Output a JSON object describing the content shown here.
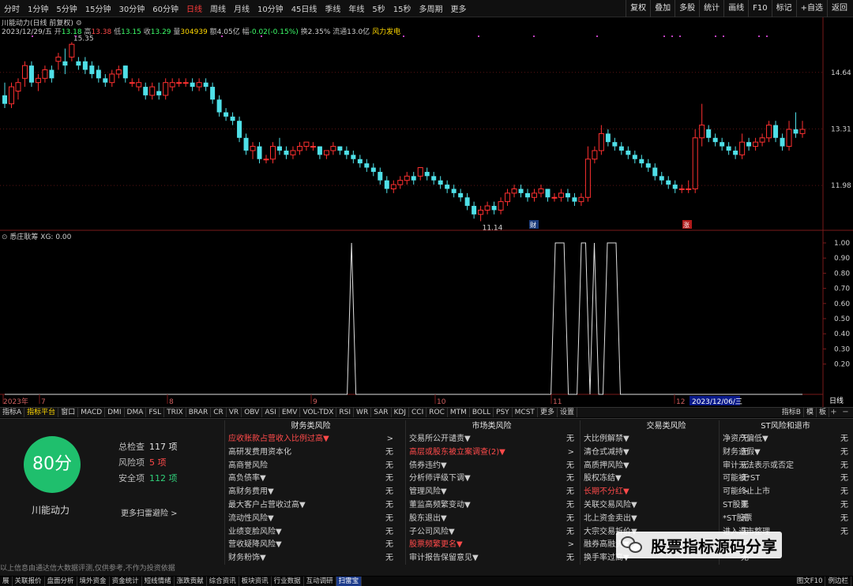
{
  "periods": [
    "分时",
    "1分钟",
    "5分钟",
    "15分钟",
    "30分钟",
    "60分钟",
    "日线",
    "周线",
    "月线",
    "10分钟",
    "45日线",
    "季线",
    "年线",
    "5秒",
    "15秒",
    "多周期",
    "更多"
  ],
  "active_period": "日线",
  "right_buttons": [
    "复权",
    "叠加",
    "多股",
    "统计",
    "画线",
    "F10",
    "标记",
    "+自选",
    "返回"
  ],
  "chart_header": {
    "name": "川能动力(日线 前复权)",
    "date": "2023/12/29/五",
    "open_lbl": "开",
    "open": "13.18",
    "high_lbl": "高",
    "high": "13.38",
    "low_lbl": "低",
    "low": "13.15",
    "close_lbl": "收",
    "close": "13.29",
    "vol_lbl": "量",
    "vol": "304939",
    "amt_lbl": "额",
    "amt": "4.05亿",
    "chg_lbl": "幅",
    "chg": "-0.02(-0.15%)",
    "turn_lbl": "换",
    "turn": "2.35%",
    "float_lbl": "流通",
    "float": "13.0亿",
    "concept": "风力发电"
  },
  "price_marks": {
    "high": "15.35",
    "low": "11.14",
    "badge_cai": "财",
    "badge_zhang": "涨"
  },
  "price_axis": [
    "14.64",
    "13.31",
    "11.98"
  ],
  "indicator_title": "悉庄耿筹  XG: 0.00",
  "indicator_axis": [
    "1.00",
    "0.90",
    "0.80",
    "0.70",
    "0.60",
    "0.50",
    "0.40",
    "0.30",
    "0.20"
  ],
  "time_axis": [
    "2023年",
    "7",
    "8",
    "9",
    "10",
    "11",
    "12"
  ],
  "time_cursor": "2023/12/06/三",
  "day_tab": "日线",
  "ind_tabs": [
    "指标A",
    "指标平台",
    "窗口",
    "MACD",
    "DMI",
    "DMA",
    "FSL",
    "TRIX",
    "BRAR",
    "CR",
    "VR",
    "OBV",
    "ASI",
    "EMV",
    "VOL-TDX",
    "RSI",
    "WR",
    "SAR",
    "KDJ",
    "CCI",
    "ROC",
    "MTM",
    "BOLL",
    "PSY",
    "MCST",
    "更多",
    "设置"
  ],
  "ind_tabs_end": [
    "指标B",
    "模",
    "板"
  ],
  "score": "80分",
  "stock_name": "川能动力",
  "stats": [
    {
      "label": "总检查",
      "value": "117 项"
    },
    {
      "label": "风险项",
      "value": "5 项"
    },
    {
      "label": "安全项",
      "value": "112 项"
    }
  ],
  "more_scan": "更多扫雷避险 >",
  "columns": [
    {
      "title": "财务类风险",
      "rows": [
        {
          "label": "应收账款占营收入比例过高▼",
          "value": ">",
          "red": true
        },
        {
          "label": "高研发费用资本化",
          "value": "无"
        },
        {
          "label": "高商誉风险",
          "value": "无"
        },
        {
          "label": "高负债率▼",
          "value": "无"
        },
        {
          "label": "高财务费用▼",
          "value": "无"
        },
        {
          "label": "最大客户占营收过高▼",
          "value": "无"
        },
        {
          "label": "流动性风险▼",
          "value": "无"
        },
        {
          "label": "业绩变脸风险▼",
          "value": "无"
        },
        {
          "label": "营收疑降风险▼",
          "value": "无"
        },
        {
          "label": "财务粉饰▼",
          "value": "无"
        }
      ]
    },
    {
      "title": "市场类风险",
      "rows": [
        {
          "label": "交易所公开谴责▼",
          "value": "无"
        },
        {
          "label": "高层或股东被立案调查(2)▼",
          "value": ">",
          "red": true
        },
        {
          "label": "债券违约▼",
          "value": "无"
        },
        {
          "label": "分析师评级下调▼",
          "value": "无"
        },
        {
          "label": "管理风险▼",
          "value": "无"
        },
        {
          "label": "董监高频繁变动▼",
          "value": "无"
        },
        {
          "label": "股东退出▼",
          "value": "无"
        },
        {
          "label": "子公司风险▼",
          "value": "无"
        },
        {
          "label": "股票频繁更名▼",
          "value": ">",
          "red": true
        },
        {
          "label": "审计报告保留意见▼",
          "value": "无"
        }
      ]
    },
    {
      "title": "交易类风险",
      "rows": [
        {
          "label": "大比例解禁▼",
          "value": "无"
        },
        {
          "label": "清仓式减持▼",
          "value": "无"
        },
        {
          "label": "高质押风险▼",
          "value": "无"
        },
        {
          "label": "股权冻结▼",
          "value": "无"
        },
        {
          "label": "长期不分红▼",
          "value": ">",
          "red": true
        },
        {
          "label": "关联交易风险▼",
          "value": "无"
        },
        {
          "label": "北上资金卖出▼",
          "value": "无"
        },
        {
          "label": "大宗交易折价▼",
          "value": "无"
        },
        {
          "label": "融券高融资▼",
          "value": "无"
        },
        {
          "label": "换手率过高▼",
          "value": "无"
        }
      ]
    },
    {
      "title": "ST风险和退市",
      "rows": [
        {
          "label": "净资产偏低▼",
          "value": "无"
        },
        {
          "label": "财务造假▼",
          "value": "无"
        },
        {
          "label": "审计无法表示或否定",
          "value": "无"
        },
        {
          "label": "可能被*ST",
          "value": "无"
        },
        {
          "label": "可能终止上市",
          "value": "无"
        },
        {
          "label": "ST股票",
          "value": "无"
        },
        {
          "label": "*ST股票",
          "value": "无"
        },
        {
          "label": "进入退市整理",
          "value": "无"
        }
      ]
    }
  ],
  "watermark": "股票指标源码分享",
  "disclaimer": "以上信息由通达信大数据评测,仅供参考,不作为投资依据",
  "func_bar": [
    "展",
    "关联报价",
    "盘面分析",
    "境外资金",
    "资金统计",
    "短线情绪",
    "涨跌贡献",
    "综合资讯",
    "板块资讯",
    "行业数据",
    "互动调研",
    "扫雷宝"
  ],
  "func_bar_right": [
    "图文F10",
    "例边栏"
  ],
  "chart_data": [
    {
      "type": "candlestick",
      "series_name": "川能动力",
      "ylim": [
        11.0,
        15.6
      ],
      "candles_ohlc": [
        [
          14.1,
          14.4,
          13.8,
          13.9
        ],
        [
          13.9,
          14.4,
          13.8,
          14.3
        ],
        [
          14.2,
          14.5,
          14.0,
          14.4
        ],
        [
          14.5,
          14.9,
          14.3,
          14.8
        ],
        [
          14.8,
          14.9,
          14.3,
          14.4
        ],
        [
          14.4,
          14.6,
          14.2,
          14.5
        ],
        [
          14.5,
          14.8,
          14.4,
          14.7
        ],
        [
          14.7,
          14.8,
          14.4,
          14.5
        ],
        [
          14.9,
          15.1,
          14.7,
          15.0
        ],
        [
          14.9,
          15.2,
          14.6,
          14.8
        ],
        [
          15.0,
          15.35,
          14.9,
          15.3
        ],
        [
          14.9,
          15.0,
          14.7,
          14.8
        ],
        [
          14.9,
          15.0,
          14.6,
          14.7
        ],
        [
          14.8,
          14.9,
          14.5,
          14.6
        ],
        [
          14.7,
          14.8,
          14.4,
          14.5
        ],
        [
          14.5,
          14.6,
          14.3,
          14.4
        ],
        [
          14.4,
          14.7,
          14.3,
          14.6
        ],
        [
          14.6,
          14.8,
          14.5,
          14.7
        ],
        [
          14.8,
          14.8,
          14.4,
          14.5
        ],
        [
          14.4,
          14.5,
          14.3,
          14.4
        ],
        [
          14.3,
          14.5,
          14.2,
          14.4
        ],
        [
          14.3,
          14.4,
          14.0,
          14.1
        ],
        [
          14.1,
          14.4,
          14.0,
          14.3
        ],
        [
          14.2,
          14.4,
          14.0,
          14.1
        ],
        [
          14.1,
          14.5,
          14.0,
          14.4
        ],
        [
          14.3,
          14.5,
          14.2,
          14.4
        ],
        [
          14.4,
          14.5,
          14.3,
          14.4
        ],
        [
          14.4,
          14.5,
          14.3,
          14.4
        ],
        [
          14.4,
          14.5,
          14.2,
          14.3
        ],
        [
          14.3,
          14.5,
          14.2,
          14.4
        ],
        [
          14.4,
          14.5,
          14.2,
          14.3
        ],
        [
          14.3,
          14.4,
          13.9,
          14.0
        ],
        [
          14.0,
          14.1,
          13.6,
          13.7
        ],
        [
          13.7,
          13.8,
          13.5,
          13.6
        ],
        [
          13.6,
          13.7,
          13.4,
          13.5
        ],
        [
          13.5,
          13.6,
          13.0,
          13.1
        ],
        [
          13.1,
          13.2,
          12.7,
          12.8
        ],
        [
          12.8,
          13.0,
          12.6,
          12.9
        ],
        [
          12.9,
          13.0,
          12.5,
          12.6
        ],
        [
          12.6,
          12.7,
          12.5,
          12.6
        ],
        [
          12.6,
          13.0,
          12.5,
          12.9
        ],
        [
          12.9,
          13.1,
          12.7,
          12.8
        ],
        [
          12.8,
          12.9,
          12.6,
          12.7
        ],
        [
          12.7,
          12.9,
          12.6,
          12.8
        ],
        [
          12.8,
          13.0,
          12.7,
          12.9
        ],
        [
          12.9,
          13.0,
          12.8,
          13.0
        ],
        [
          12.9,
          13.0,
          12.8,
          12.9
        ],
        [
          12.9,
          12.9,
          12.6,
          12.7
        ],
        [
          12.7,
          12.8,
          12.6,
          12.8
        ],
        [
          12.8,
          13.0,
          12.7,
          12.9
        ],
        [
          12.9,
          12.9,
          12.7,
          12.8
        ],
        [
          12.8,
          12.9,
          12.6,
          12.7
        ],
        [
          12.7,
          12.8,
          12.5,
          12.6
        ],
        [
          12.6,
          12.7,
          12.4,
          12.5
        ],
        [
          12.5,
          12.6,
          12.3,
          12.4
        ],
        [
          12.4,
          12.5,
          12.2,
          12.3
        ],
        [
          12.3,
          12.4,
          12.0,
          12.1
        ],
        [
          12.1,
          12.2,
          11.8,
          11.9
        ],
        [
          11.9,
          12.1,
          11.8,
          12.0
        ],
        [
          12.0,
          12.2,
          11.9,
          12.1
        ],
        [
          12.1,
          12.3,
          12.0,
          12.2
        ],
        [
          12.2,
          12.3,
          12.0,
          12.1
        ],
        [
          12.2,
          12.4,
          12.1,
          12.4
        ],
        [
          12.3,
          12.4,
          12.1,
          12.2
        ],
        [
          12.2,
          12.3,
          12.0,
          12.1
        ],
        [
          12.1,
          12.2,
          11.9,
          12.0
        ],
        [
          12.0,
          12.1,
          11.8,
          11.9
        ],
        [
          11.9,
          12.0,
          11.7,
          11.8
        ],
        [
          11.8,
          11.9,
          11.6,
          11.7
        ],
        [
          11.7,
          11.8,
          11.4,
          11.5
        ],
        [
          11.5,
          11.6,
          11.2,
          11.3
        ],
        [
          11.3,
          11.5,
          11.14,
          11.4
        ],
        [
          11.4,
          11.6,
          11.3,
          11.5
        ],
        [
          11.5,
          11.6,
          11.3,
          11.4
        ],
        [
          11.4,
          11.7,
          11.3,
          11.6
        ],
        [
          11.6,
          11.9,
          11.5,
          11.8
        ],
        [
          11.8,
          12.0,
          11.7,
          11.9
        ],
        [
          11.9,
          12.0,
          11.7,
          11.8
        ],
        [
          11.8,
          11.9,
          11.6,
          11.7
        ],
        [
          11.7,
          11.9,
          11.6,
          11.8
        ],
        [
          11.8,
          12.0,
          11.7,
          11.9
        ],
        [
          11.9,
          11.9,
          11.6,
          11.7
        ],
        [
          11.7,
          11.8,
          11.6,
          11.7
        ],
        [
          11.7,
          11.9,
          11.6,
          11.8
        ],
        [
          11.8,
          11.9,
          11.6,
          11.7
        ],
        [
          11.7,
          11.8,
          11.5,
          11.6
        ],
        [
          11.6,
          11.8,
          11.5,
          11.7
        ],
        [
          11.7,
          12.9,
          11.6,
          12.6
        ],
        [
          12.6,
          12.9,
          12.5,
          12.8
        ],
        [
          12.8,
          13.4,
          12.7,
          13.2
        ],
        [
          13.2,
          13.3,
          12.9,
          13.0
        ],
        [
          13.0,
          13.1,
          12.8,
          12.9
        ],
        [
          12.9,
          13.0,
          12.7,
          12.8
        ],
        [
          12.8,
          12.9,
          12.6,
          12.7
        ],
        [
          12.7,
          12.8,
          12.5,
          12.6
        ],
        [
          12.6,
          12.7,
          12.4,
          12.5
        ],
        [
          12.5,
          12.6,
          12.3,
          12.4
        ],
        [
          12.4,
          12.5,
          12.1,
          12.2
        ],
        [
          12.2,
          12.3,
          12.0,
          12.1
        ],
        [
          12.1,
          12.2,
          11.9,
          12.0
        ],
        [
          12.0,
          12.1,
          11.8,
          11.9
        ],
        [
          11.9,
          12.0,
          11.8,
          11.9
        ],
        [
          11.9,
          12.1,
          11.8,
          11.9
        ],
        [
          11.9,
          13.3,
          11.8,
          13.1
        ],
        [
          13.1,
          13.9,
          12.9,
          13.4
        ],
        [
          13.3,
          13.4,
          13.0,
          13.1
        ],
        [
          13.1,
          13.2,
          12.9,
          13.0
        ],
        [
          13.0,
          13.1,
          12.8,
          12.9
        ],
        [
          12.9,
          13.0,
          12.7,
          12.8
        ],
        [
          12.8,
          12.9,
          12.6,
          12.7
        ],
        [
          12.7,
          13.2,
          12.6,
          13.0
        ],
        [
          13.0,
          13.1,
          12.8,
          12.9
        ],
        [
          12.9,
          13.1,
          12.8,
          13.0
        ],
        [
          13.0,
          13.2,
          12.9,
          13.1
        ],
        [
          13.1,
          13.5,
          13.0,
          13.4
        ],
        [
          13.4,
          13.5,
          13.0,
          13.1
        ],
        [
          13.1,
          13.2,
          12.8,
          12.9
        ],
        [
          12.9,
          13.5,
          12.8,
          13.3
        ],
        [
          13.3,
          13.7,
          13.1,
          13.2
        ],
        [
          13.2,
          13.5,
          13.1,
          13.3
        ]
      ],
      "y_ticks": [
        14.64,
        13.31,
        11.98
      ]
    },
    {
      "type": "line",
      "series_name": "XG",
      "ylim": [
        0,
        1.0
      ],
      "values_sequence": [
        0,
        0,
        0,
        0,
        0,
        0,
        0,
        0,
        0,
        0,
        0,
        0,
        0,
        0,
        0,
        0,
        0,
        0,
        0,
        0,
        0,
        0,
        0,
        0,
        0,
        0,
        0,
        0,
        0,
        0,
        0,
        0,
        0,
        0,
        0,
        0,
        0,
        0,
        0,
        0,
        0,
        0,
        0,
        0,
        0,
        0,
        0,
        0,
        0,
        0,
        0,
        0,
        0,
        0,
        0,
        0,
        0,
        0,
        0,
        0,
        0,
        0,
        0,
        0,
        0,
        0,
        0,
        0,
        0,
        0,
        0,
        0,
        0,
        0,
        0,
        0,
        0,
        0,
        0,
        0,
        1,
        0,
        0,
        0,
        0,
        0,
        0,
        0,
        0,
        0,
        0,
        0,
        0,
        0,
        0,
        0,
        0,
        0,
        0,
        0,
        0,
        0,
        0,
        0,
        0,
        0,
        0,
        0,
        0,
        0,
        0,
        0,
        0,
        0,
        0,
        0,
        0,
        0,
        0,
        0,
        0,
        0,
        0,
        0,
        0,
        0,
        0,
        1,
        1,
        1,
        0,
        0,
        0,
        1,
        1,
        0,
        1,
        0,
        0,
        1,
        1,
        1,
        0,
        0,
        0,
        0,
        0,
        0,
        0,
        0,
        0,
        0,
        0,
        0,
        0,
        0,
        0,
        0,
        0,
        0,
        0,
        0,
        0,
        0,
        0,
        0,
        0,
        0,
        0,
        0,
        0,
        0,
        0,
        0,
        0,
        0,
        0,
        0,
        0,
        0,
        0,
        0,
        0,
        0,
        0
      ],
      "y_ticks": [
        1.0,
        0.9,
        0.8,
        0.7,
        0.6,
        0.5,
        0.4,
        0.3,
        0.2
      ]
    }
  ]
}
